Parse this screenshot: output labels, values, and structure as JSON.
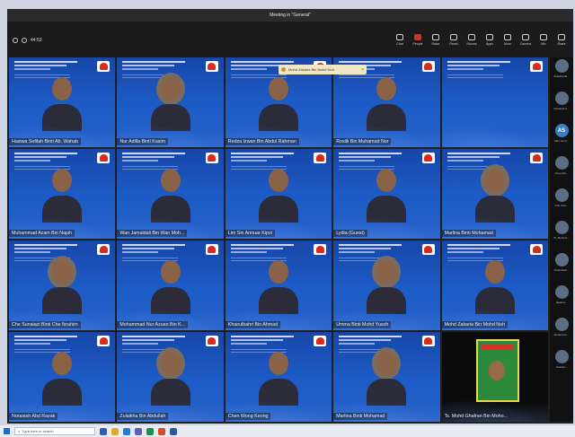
{
  "window_title": "Meeting in \"General\"",
  "left_timer": "44:53",
  "toolbar": [
    {
      "label": "Chat",
      "red": false
    },
    {
      "label": "People",
      "red": true
    },
    {
      "label": "Raise",
      "red": false
    },
    {
      "label": "React",
      "red": false
    },
    {
      "label": "Rooms",
      "red": false
    },
    {
      "label": "Apps",
      "red": false
    },
    {
      "label": "More",
      "red": false
    },
    {
      "label": "Camera",
      "red": false
    },
    {
      "label": "Mic",
      "red": false
    },
    {
      "label": "Share",
      "red": false
    }
  ],
  "popup": {
    "text": "Mohd Zakaria Bin Mohd Noh"
  },
  "participants": [
    {
      "name": "Hasiwa Sofilah Binti Ab. Wahab"
    },
    {
      "name": "Nur Adilla Binti Kasim"
    },
    {
      "name": "Redza Izwan Bin Abdul Rahman"
    },
    {
      "name": "Roslili Bin Muhamad Nor"
    },
    {
      "name": ""
    },
    {
      "name": "Muhammad Azam Bin Najah"
    },
    {
      "name": "Wan Jamaldali Bin Wan Moh..."
    },
    {
      "name": "Lim Sin Annuar Kipoi"
    },
    {
      "name": "Lydia (Guest)"
    },
    {
      "name": "Marlina Binti Mohamad"
    },
    {
      "name": "Che Sunaiazi Binti Che Ibrahim"
    },
    {
      "name": "Mohammad Nur Azuan Bin K..."
    },
    {
      "name": "Khairulbahri Bin Ahmad"
    },
    {
      "name": "Umma Binti Mohd Yusoh"
    },
    {
      "name": "Mohd Zakaria Bin Mohd Noh"
    },
    {
      "name": "Norasiah Abd Razak"
    },
    {
      "name": "Zulaikha Bin Abdullah"
    },
    {
      "name": "Chen Wong Keong"
    },
    {
      "name": "Marlina Binti Mohamad"
    },
    {
      "name": "Ts. Mohd Ghafran Bin Moho..."
    }
  ],
  "side": [
    {
      "name": "Zulaikha Bi...",
      "init": ""
    },
    {
      "name": "Norasiah A...",
      "init": ""
    },
    {
      "name": "Aller Ga S...",
      "init": "AS"
    },
    {
      "name": "Chen Wo...",
      "init": ""
    },
    {
      "name": "Che Khoi...",
      "init": ""
    },
    {
      "name": "Ts. Mohd G...",
      "init": ""
    },
    {
      "name": "Khairulbah...",
      "init": ""
    },
    {
      "name": "Marlina...",
      "init": ""
    },
    {
      "name": "Muhamma...",
      "init": ""
    },
    {
      "name": "Hasiwa...",
      "init": ""
    }
  ],
  "taskbar": {
    "search": "Type here to search"
  }
}
